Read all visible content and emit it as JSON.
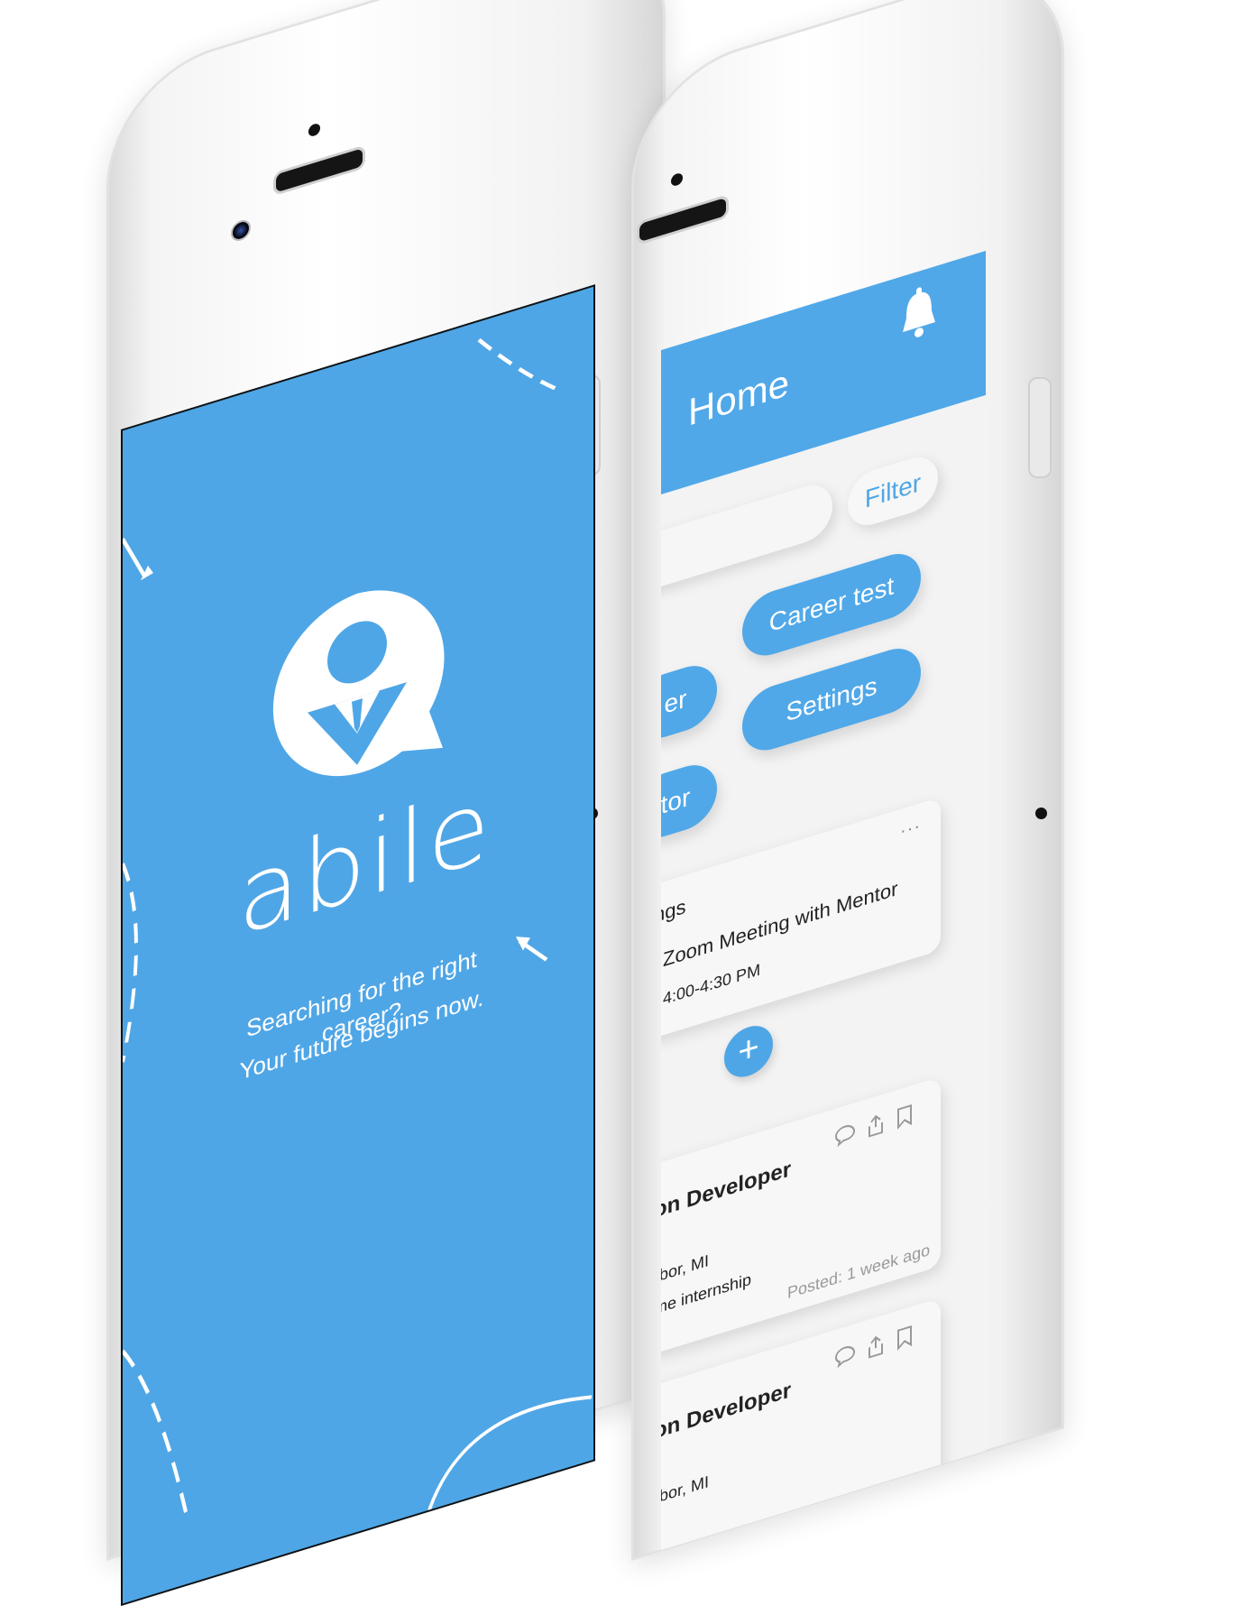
{
  "splash": {
    "brand": "abile",
    "tagline_1": "Searching for the right career?",
    "tagline_2": "Your future begins now.",
    "logo_icon": "mentor-chat-logo-icon"
  },
  "home": {
    "title": "Home",
    "filter_label": "Filter",
    "nav": {
      "left_top_partial": "er",
      "left_bottom_partial": "tor",
      "career_test": "Career test",
      "settings": "Settings"
    },
    "meetings": {
      "heading_partial": "ngs",
      "item_title": "Zoom Meeting with Mentor",
      "item_time": "4:00-4:30 PM",
      "more_label": "···"
    },
    "add_label": "+",
    "jobs": [
      {
        "title_partial": "on Developer",
        "line2": ":",
        "location_partial": "rbor, MI",
        "type_partial": "me internship",
        "posted": "Posted: 1 week ago"
      },
      {
        "title_partial": "on Developer",
        "line2": ":",
        "location_partial": "rbor, MI"
      }
    ]
  },
  "colors": {
    "brand_blue": "#4fa6e6",
    "background": "#f3f3f3",
    "white": "#ffffff"
  },
  "icons": [
    "bell-icon",
    "comment-icon",
    "share-icon",
    "bookmark-icon",
    "plus-icon"
  ]
}
